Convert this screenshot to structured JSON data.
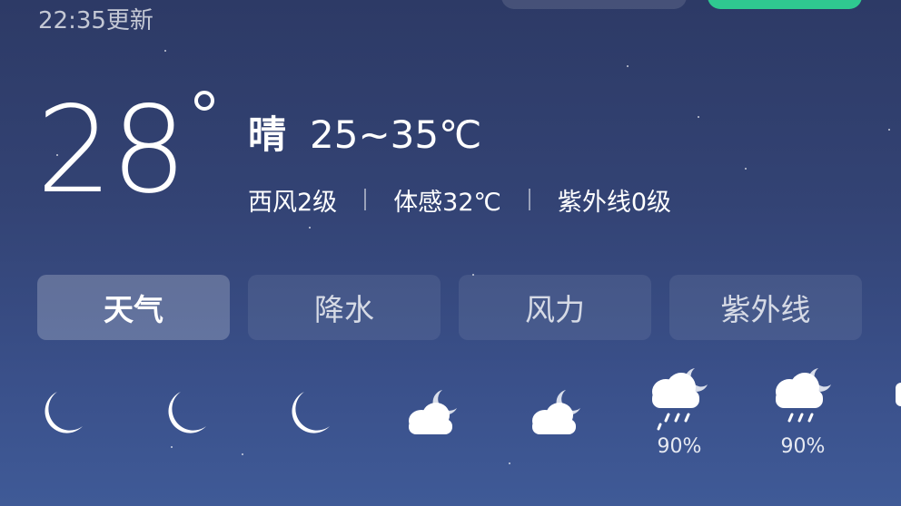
{
  "header": {
    "update_time": "22:35更新"
  },
  "current": {
    "temperature": "28",
    "condition": "晴",
    "range": "25~35℃",
    "wind": "西风2级",
    "feels_like": "体感32℃",
    "uv": "紫外线0级"
  },
  "tabs": [
    {
      "label": "天气",
      "active": true
    },
    {
      "label": "降水",
      "active": false
    },
    {
      "label": "风力",
      "active": false
    },
    {
      "label": "紫外线",
      "active": false
    }
  ],
  "hourly": [
    {
      "icon": "moon-icon",
      "precip": ""
    },
    {
      "icon": "moon-icon",
      "precip": ""
    },
    {
      "icon": "moon-icon",
      "precip": ""
    },
    {
      "icon": "cloudy-night-icon",
      "precip": ""
    },
    {
      "icon": "cloudy-night-icon",
      "precip": ""
    },
    {
      "icon": "rain-night-icon",
      "precip": "90%"
    },
    {
      "icon": "rain-night-icon",
      "precip": "90%"
    }
  ],
  "colors": {
    "background_top": "#2d3a66",
    "background_bottom": "#3f5a97",
    "accent_green": "#2fc990"
  }
}
